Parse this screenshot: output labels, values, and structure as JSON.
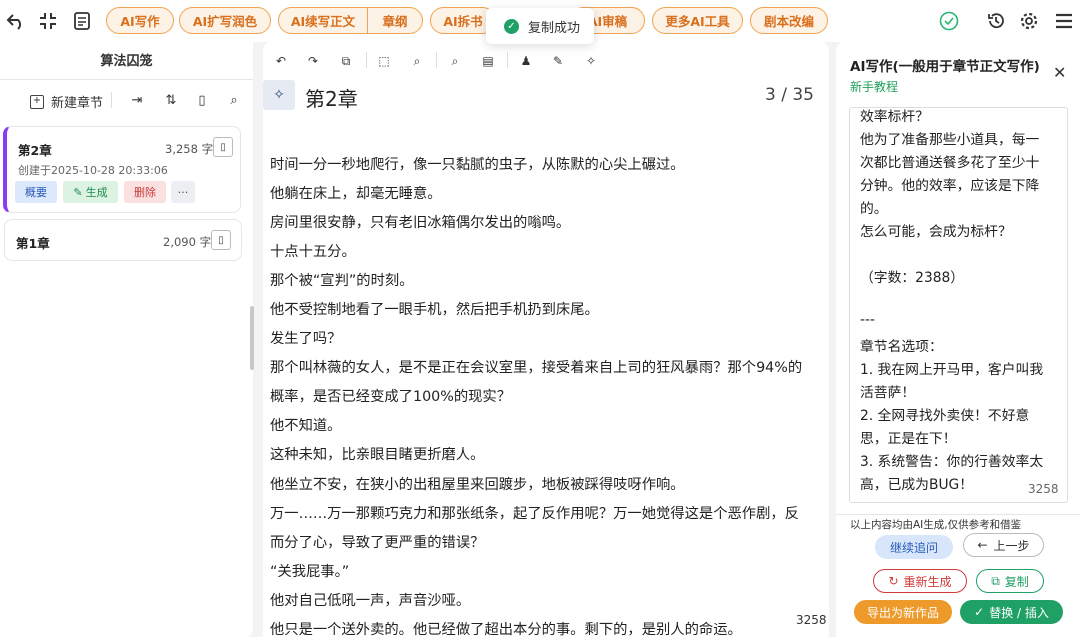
{
  "topbar": {
    "buttons": [
      "AI写作",
      "AI扩写润色",
      "AI续写正文",
      "章纲",
      "AI拆书",
      "AI审稿",
      "更多AI工具",
      "剧本改编"
    ],
    "toast": "复制成功"
  },
  "left": {
    "title": "算法囚笼",
    "new_chapter": "新建章节",
    "chapters": [
      {
        "title": "第2章",
        "count": "3,258 字",
        "created": "创建于2025-10-28 20:33:06",
        "actions": [
          "概要",
          "生成",
          "删除",
          "···"
        ]
      },
      {
        "title": "第1章",
        "count": "2,090 字"
      }
    ]
  },
  "editor": {
    "chapter_title": "第2章",
    "page": "3 / 35",
    "lines": [
      "时间一分一秒地爬行，像一只黏腻的虫子，从陈默的心尖上碾过。",
      "他躺在床上，却毫无睡意。",
      "房间里很安静，只有老旧冰箱偶尔发出的嗡鸣。",
      "十点十五分。",
      "那个被“宣判”的时刻。",
      "他不受控制地看了一眼手机，然后把手机扔到床尾。",
      "发生了吗？",
      "那个叫林薇的女人，是不是正在会议室里，接受着来自上司的狂风暴雨？那个94%的",
      "概率，是否已经变成了100%的现实？",
      "他不知道。",
      "这种未知，比亲眼目睹更折磨人。",
      "他坐立不安，在狭小的出租屋里来回踱步，地板被踩得吱呀作响。",
      "万一……万一那颗巧克力和那张纸条，起了反作用呢？万一她觉得这是个恶作剧，反",
      "而分了心，导致了更严重的错误？",
      "“关我屁事。”",
      "他对自己低吼一声，声音沙哑。",
      "他只是一个送外卖的。他已经做了超出本分的事。剩下的，是别人的命运。"
    ],
    "word_count": "3258"
  },
  "right": {
    "title": "AI写作(一般用于章节正文写作)",
    "tutorial": "新手教程",
    "output_lines": [
      "效率标杆？",
      "他为了准备那些小道具，每一",
      "次都比普通送餐多花了至少十",
      "分钟。他的效率，应该是下降",
      "的。",
      "怎么可能，会成为标杆？",
      "",
      "（字数：2388）",
      "",
      "---",
      "章节名选项：",
      "1. 我在网上开马甲，客户叫我",
      "活菩萨！",
      "2. 全网寻找外卖侠！不好意",
      "思，正是在下！",
      "3. 系统警告：你的行善效率太",
      "高，已成为BUG！"
    ],
    "output_count": "3258",
    "disclaimer": "以上内容均由AI生成,仅供参考和借鉴",
    "continue": "继续追问",
    "prev": "上一步",
    "regenerate": "重新生成",
    "copy": "复制",
    "export": "导出为新作品",
    "replace": "替换 / 插入"
  },
  "colors": {
    "accent": "#f0a350",
    "green": "#1fa064",
    "purple": "#8a3df0"
  }
}
